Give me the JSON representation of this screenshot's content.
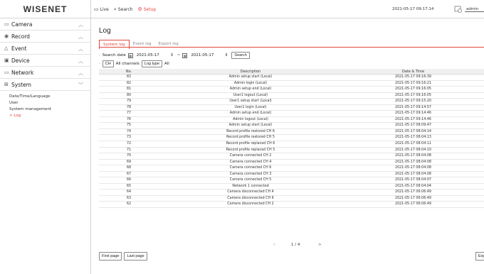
{
  "brand": {
    "logo_text": "WISENET"
  },
  "topnav": [
    {
      "label": "Live",
      "icon": "monitor-icon",
      "active": false
    },
    {
      "label": "Search",
      "icon": "search-icon",
      "active": false
    },
    {
      "label": "Setup",
      "icon": "gear-icon",
      "active": true
    }
  ],
  "header": {
    "datetime": "2021-05-17 09:17:14",
    "user": "admin"
  },
  "sidebar": {
    "menus": [
      {
        "label": "Camera",
        "icon": "camera-icon"
      },
      {
        "label": "Record",
        "icon": "record-icon"
      },
      {
        "label": "Event",
        "icon": "bell-icon"
      },
      {
        "label": "Device",
        "icon": "device-icon"
      },
      {
        "label": "Network",
        "icon": "network-icon"
      },
      {
        "label": "System",
        "icon": "system-icon"
      }
    ],
    "system_sub": [
      {
        "label": "Date/Time/Language",
        "active": false
      },
      {
        "label": "User",
        "active": false
      },
      {
        "label": "System management",
        "active": false
      },
      {
        "label": "Log",
        "active": true
      }
    ]
  },
  "main": {
    "title": "Log",
    "tabs": [
      {
        "label": "System log",
        "active": true
      },
      {
        "label": "Event log",
        "active": false
      },
      {
        "label": "Export log",
        "active": false
      }
    ],
    "filter": {
      "search_date_label": "Search date",
      "from_date": "2021-05-17",
      "separator": "~",
      "to_date": "2021-05-17",
      "search_button": "Search",
      "ch_label": "CH",
      "ch_value": "All channels",
      "logtype_label": "Log type",
      "logtype_value": "All"
    },
    "table": {
      "headers": {
        "no": "No.",
        "desc": "Description",
        "dt": "Date & Time"
      },
      "rows": [
        {
          "no": "83",
          "desc": "Admin setup start (Local)",
          "dt": "2021-05-17 09:16:39"
        },
        {
          "no": "82",
          "desc": "Admin login (Local)",
          "dt": "2021-05-17 09:16:21"
        },
        {
          "no": "81",
          "desc": "Admin setup end (Local)",
          "dt": "2021-05-17 09:16:05"
        },
        {
          "no": "80",
          "desc": "User1 logout (Local)",
          "dt": "2021-05-17 09:16:05"
        },
        {
          "no": "79",
          "desc": "User1 setup start (Local)",
          "dt": "2021-05-17 09:15:20"
        },
        {
          "no": "78",
          "desc": "User1 login (Local)",
          "dt": "2021-05-17 09:14:57"
        },
        {
          "no": "77",
          "desc": "Admin setup end (Local)",
          "dt": "2021-05-17 09:14:46"
        },
        {
          "no": "76",
          "desc": "Admin logout (Local)",
          "dt": "2021-05-17 09:14:46"
        },
        {
          "no": "75",
          "desc": "Admin setup start (Local)",
          "dt": "2021-05-17 08:09:47"
        },
        {
          "no": "74",
          "desc": "Record profile restored CH 6",
          "dt": "2021-05-17 08:04:14"
        },
        {
          "no": "73",
          "desc": "Record profile restored CH 5",
          "dt": "2021-05-17 08:04:13"
        },
        {
          "no": "72",
          "desc": "Record profile replaced CH 6",
          "dt": "2021-05-17 08:04:11"
        },
        {
          "no": "71",
          "desc": "Record profile replaced CH 5",
          "dt": "2021-05-17 08:04:10"
        },
        {
          "no": "70",
          "desc": "Camera connected CH 2",
          "dt": "2021-05-17 08:04:08"
        },
        {
          "no": "69",
          "desc": "Camera connected CH 4",
          "dt": "2021-05-17 08:04:08"
        },
        {
          "no": "68",
          "desc": "Camera connected CH 6",
          "dt": "2021-05-17 08:04:08"
        },
        {
          "no": "67",
          "desc": "Camera connected CH 3",
          "dt": "2021-05-17 08:04:08"
        },
        {
          "no": "66",
          "desc": "Camera connected CH 5",
          "dt": "2021-05-17 08:04:07"
        },
        {
          "no": "65",
          "desc": "Network 1 connected",
          "dt": "2021-05-17 08:04:04"
        },
        {
          "no": "64",
          "desc": "Camera disconnected CH 4",
          "dt": "2021-05-17 06:06:49"
        },
        {
          "no": "63",
          "desc": "Camera disconnected CH 6",
          "dt": "2021-05-17 06:06:49"
        },
        {
          "no": "62",
          "desc": "Camera disconnected CH 2",
          "dt": "2021-05-17 06:06:49"
        }
      ]
    },
    "pager": {
      "prev": "<",
      "page": "1 / 4",
      "next": ">"
    },
    "buttons": {
      "first_page": "First page",
      "last_page": "Last page",
      "export": "Export"
    }
  },
  "colors": {
    "accent": "#e2473c"
  }
}
